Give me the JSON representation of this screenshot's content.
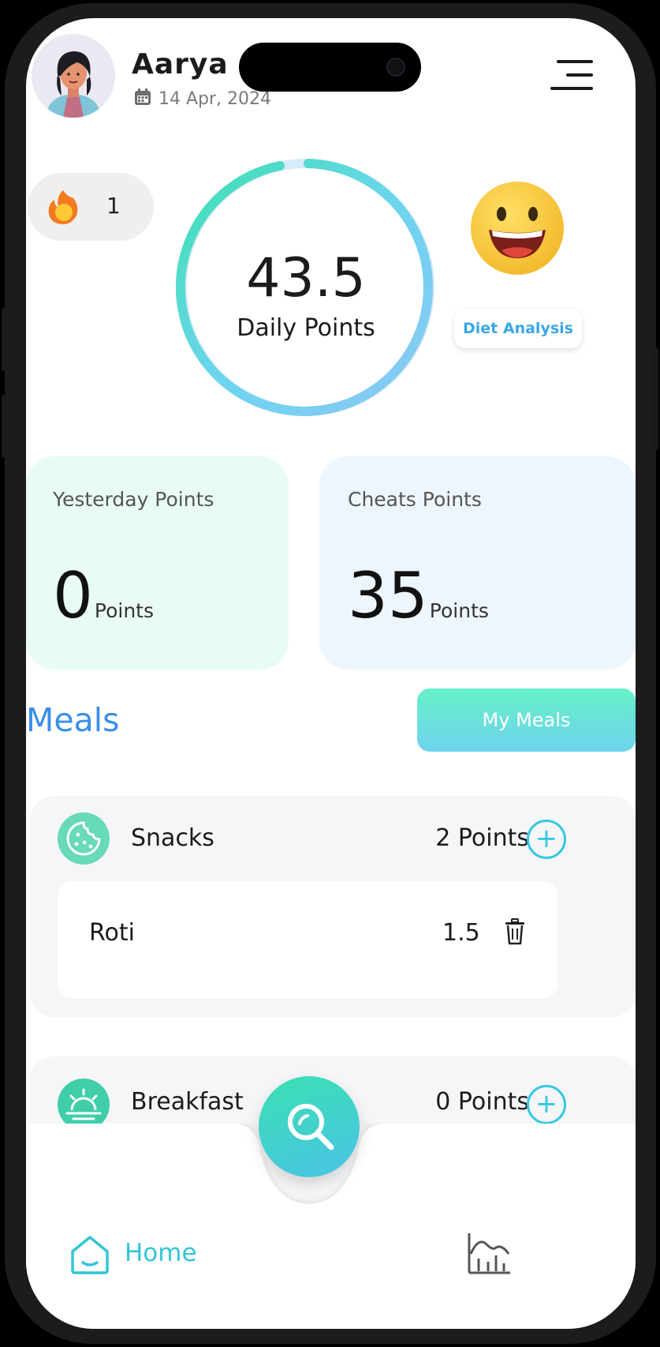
{
  "header": {
    "user_name": "Aarya",
    "date": "14 Apr, 2024",
    "icons": {
      "avatar": "user-avatar",
      "calendar": "calendar-icon",
      "menu": "hamburger-menu-icon"
    }
  },
  "streak": {
    "count": "1",
    "icon": "flame-icon"
  },
  "daily": {
    "value": "43.5",
    "label": "Daily Points"
  },
  "mood": {
    "icon": "happy-face-emoji",
    "button_label": "Diet Analysis"
  },
  "cards": {
    "yesterday": {
      "title": "Yesterday Points",
      "value": "0",
      "unit": "Points"
    },
    "cheats": {
      "title": "Cheats Points",
      "value": "35",
      "unit": "Points"
    }
  },
  "meals": {
    "title": "Meals",
    "button_label": "My Meals",
    "sections": [
      {
        "name": "Snacks",
        "points": "2 Points",
        "icon": "cookie-icon",
        "items": [
          {
            "name": "Roti",
            "value": "1.5"
          }
        ]
      },
      {
        "name": "Breakfast",
        "points": "0 Points",
        "icon": "sunrise-icon",
        "items": []
      }
    ]
  },
  "nav": {
    "home_label": "Home",
    "icons": {
      "home": "home-icon",
      "search": "search-icon",
      "stats": "stats-icon"
    }
  },
  "colors": {
    "accent_blue": "#3a8ee8",
    "accent_teal": "#35c8e0",
    "accent_green": "#3be0b2",
    "card_mint": "#e9fbf6",
    "card_sky": "#edf6fd"
  }
}
